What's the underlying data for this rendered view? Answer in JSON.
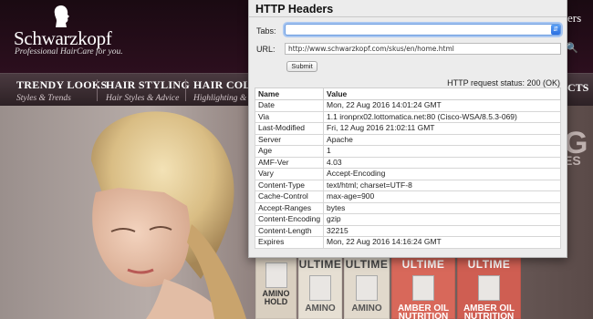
{
  "site": {
    "brand": "Schwarzkopf",
    "tagline": "Professional HairCare for you.",
    "header_partial": "ers",
    "search_partial": "Q",
    "nav": [
      {
        "title": "TRENDY LOOKS",
        "subtitle": "Styles & Trends"
      },
      {
        "title": "HAIR STYLING",
        "subtitle": "Hair Styles & Advice"
      },
      {
        "title": "HAIR COLOR",
        "subtitle": "Highlighting & C"
      }
    ],
    "nav_right_partial": "CTS",
    "hero_text_partial": "G",
    "hero_text_partial2": "ES",
    "products": [
      {
        "brand": "",
        "label": "AMINO\nHOLD",
        "color": "#d9cfc0"
      },
      {
        "brand": "ULTIME",
        "label": "AMINO",
        "color": "#e6dfd3"
      },
      {
        "brand": "ULTIME",
        "label": "AMINO",
        "color": "#e1d9cc"
      },
      {
        "brand": "ULTIME",
        "label": "AMBER OIL\nNUTRITION",
        "color": "#d8685a"
      },
      {
        "brand": "ULTIME",
        "label": "AMBER OIL\nNUTRITION",
        "color": "#cf5e52"
      }
    ]
  },
  "panel": {
    "title": "HTTP Headers",
    "tabs_label": "Tabs:",
    "tabs_value": "",
    "url_label": "URL:",
    "url_value": "http://www.schwarzkopf.com/skus/en/home.html",
    "submit_label": "Submit",
    "status_text": "HTTP request status: 200 (OK)",
    "columns": [
      "Name",
      "Value"
    ],
    "rows": [
      [
        "Date",
        "Mon, 22 Aug 2016 14:01:24 GMT"
      ],
      [
        "Via",
        "1.1 ironprx02.lottomatica.net:80 (Cisco-WSA/8.5.3-069)"
      ],
      [
        "Last-Modified",
        "Fri, 12 Aug 2016 21:02:11 GMT"
      ],
      [
        "Server",
        "Apache"
      ],
      [
        "Age",
        "1"
      ],
      [
        "AMF-Ver",
        "4.03"
      ],
      [
        "Vary",
        "Accept-Encoding"
      ],
      [
        "Content-Type",
        "text/html; charset=UTF-8"
      ],
      [
        "Cache-Control",
        "max-age=900"
      ],
      [
        "Accept-Ranges",
        "bytes"
      ],
      [
        "Content-Encoding",
        "gzip"
      ],
      [
        "Content-Length",
        "32215"
      ],
      [
        "Expires",
        "Mon, 22 Aug 2016 14:16:24 GMT"
      ]
    ]
  },
  "colors": {
    "site_header": "#2c0f1e",
    "panel_bg": "#ececec",
    "select_focus": "#6a9be0"
  }
}
